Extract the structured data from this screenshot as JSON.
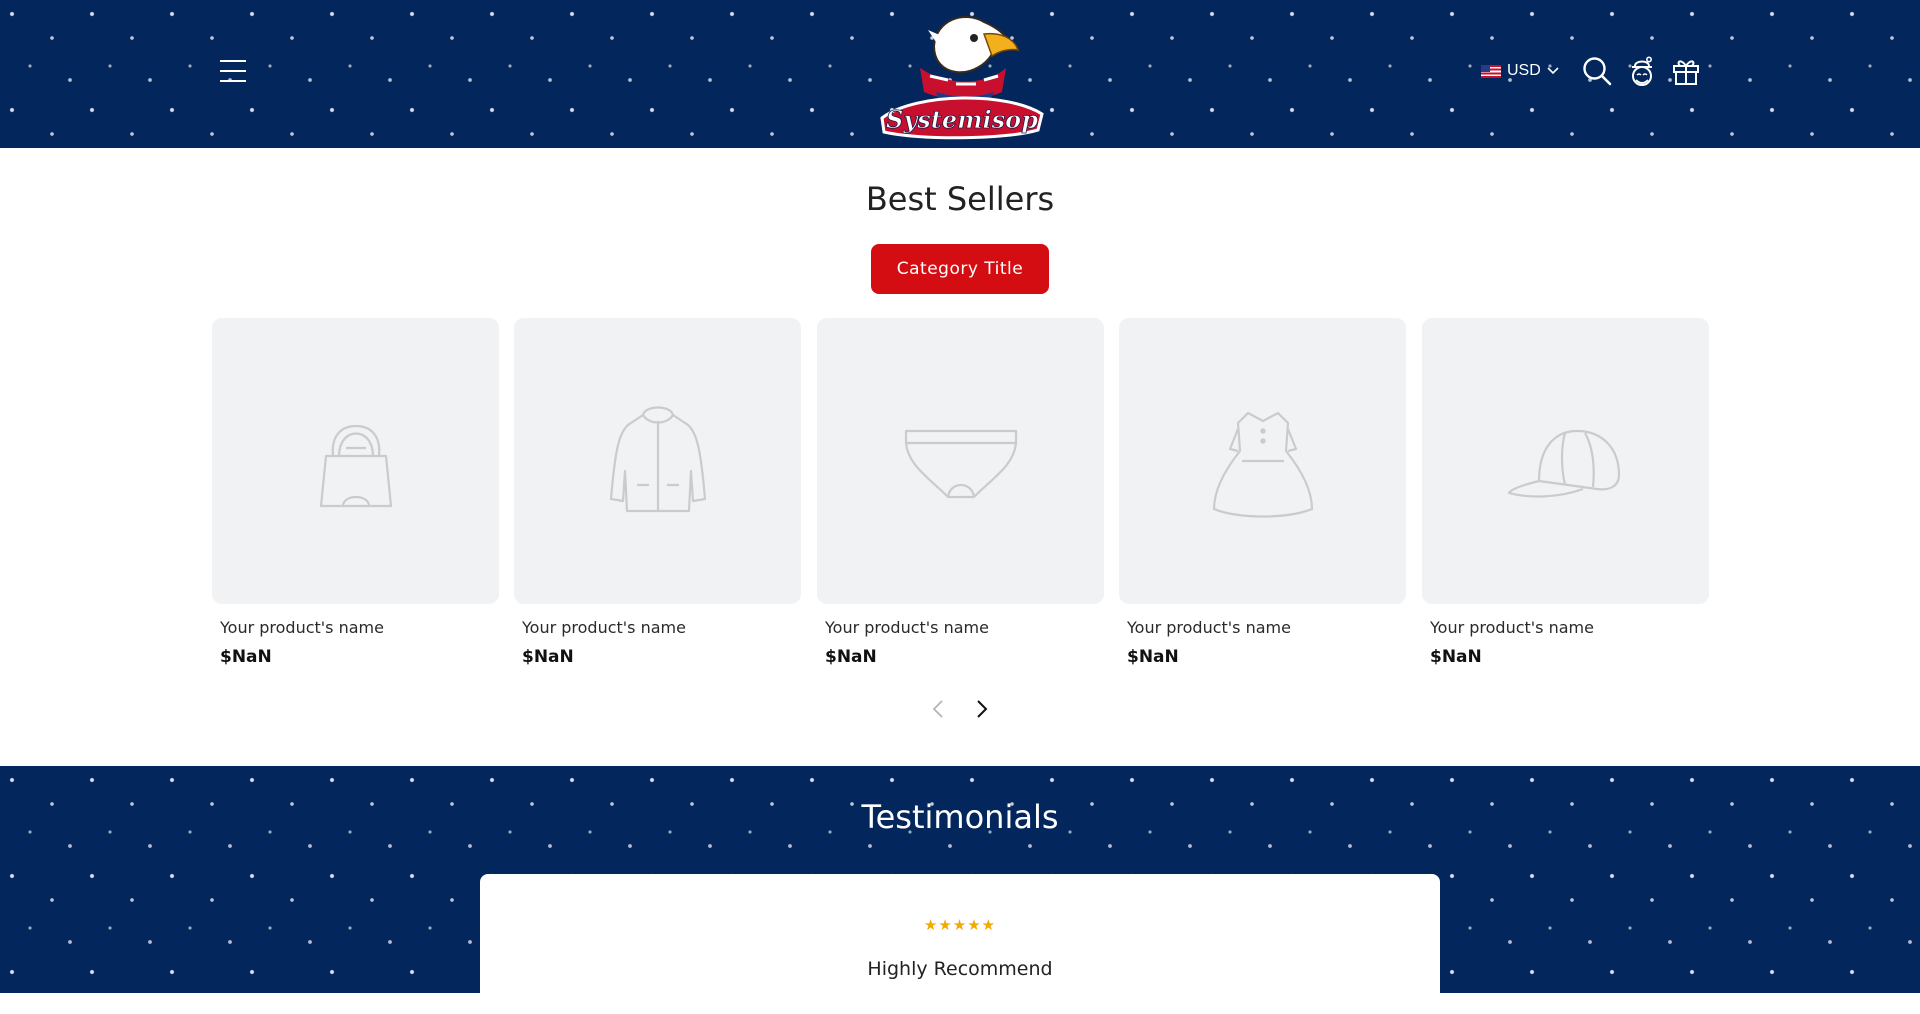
{
  "header": {
    "currency": "USD",
    "menu_icon": "hamburger-menu-icon",
    "icons": [
      "search-icon",
      "account-icon",
      "gift-icon"
    ],
    "logo_text": "Systemisop"
  },
  "best_sellers": {
    "title": "Best Sellers",
    "category_button": "Category Title",
    "products": [
      {
        "name": "Your product's name",
        "price": "$NaN",
        "icon": "duffel-bag-icon"
      },
      {
        "name": "Your product's name",
        "price": "$NaN",
        "icon": "jacket-icon"
      },
      {
        "name": "Your product's name",
        "price": "$NaN",
        "icon": "underwear-icon"
      },
      {
        "name": "Your product's name",
        "price": "$NaN",
        "icon": "dress-icon"
      },
      {
        "name": "Your product's name",
        "price": "$NaN",
        "icon": "cap-icon"
      }
    ]
  },
  "testimonials": {
    "title": "Testimonials",
    "rating": 5,
    "stars": "★★★★★",
    "heading": "Highly Recommend"
  },
  "colors": {
    "navy": "#03265c",
    "accent_red": "#d40d12",
    "star": "#f2a900",
    "placeholder_bg": "#f1f2f4"
  }
}
